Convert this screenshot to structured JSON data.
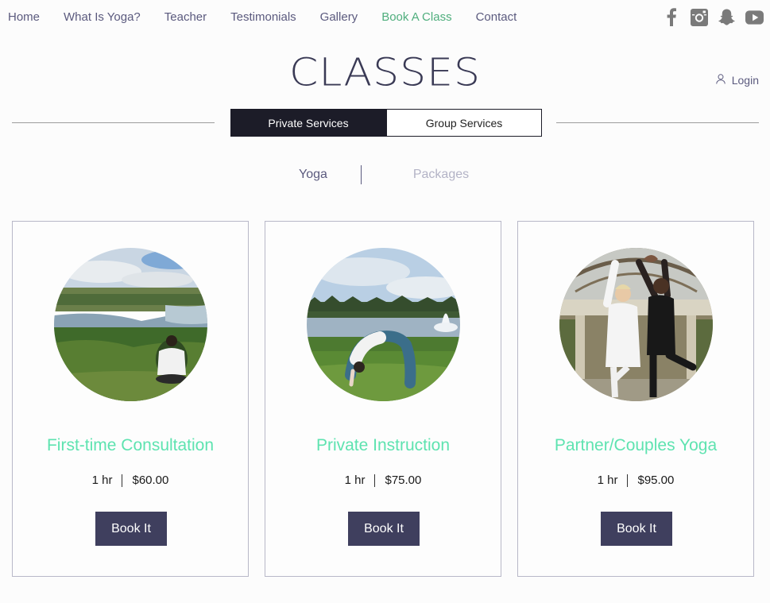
{
  "nav": {
    "items": [
      {
        "label": "Home",
        "active": false
      },
      {
        "label": "What Is Yoga?",
        "active": false
      },
      {
        "label": "Teacher",
        "active": false
      },
      {
        "label": "Testimonials",
        "active": false
      },
      {
        "label": "Gallery",
        "active": false
      },
      {
        "label": "Book A Class",
        "active": true
      },
      {
        "label": "Contact",
        "active": false
      }
    ]
  },
  "social": {
    "icons": [
      "facebook-icon",
      "instagram-icon",
      "snapchat-icon",
      "youtube-icon"
    ],
    "color": "#7a7a7a"
  },
  "page": {
    "title": "CLASSES",
    "login_label": "Login"
  },
  "service_tabs": {
    "items": [
      {
        "label": "Private Services",
        "selected": true
      },
      {
        "label": "Group Services",
        "selected": false
      }
    ]
  },
  "categories": {
    "items": [
      {
        "label": "Yoga",
        "active": true
      },
      {
        "label": "Packages",
        "active": false
      }
    ]
  },
  "cards": [
    {
      "title": "First-time Consultation",
      "duration": "1 hr",
      "price": "$60.00",
      "button": "Book It"
    },
    {
      "title": "Private Instruction",
      "duration": "1 hr",
      "price": "$75.00",
      "button": "Book It"
    },
    {
      "title": "Partner/Couples Yoga",
      "duration": "1 hr",
      "price": "$95.00",
      "button": "Book It"
    }
  ],
  "colors": {
    "accent_green": "#4fae7d",
    "card_title": "#5ee3b0",
    "button_bg": "#3f3f5e",
    "nav_text": "#5b5a7e",
    "tab_dark": "#1c1c28"
  }
}
